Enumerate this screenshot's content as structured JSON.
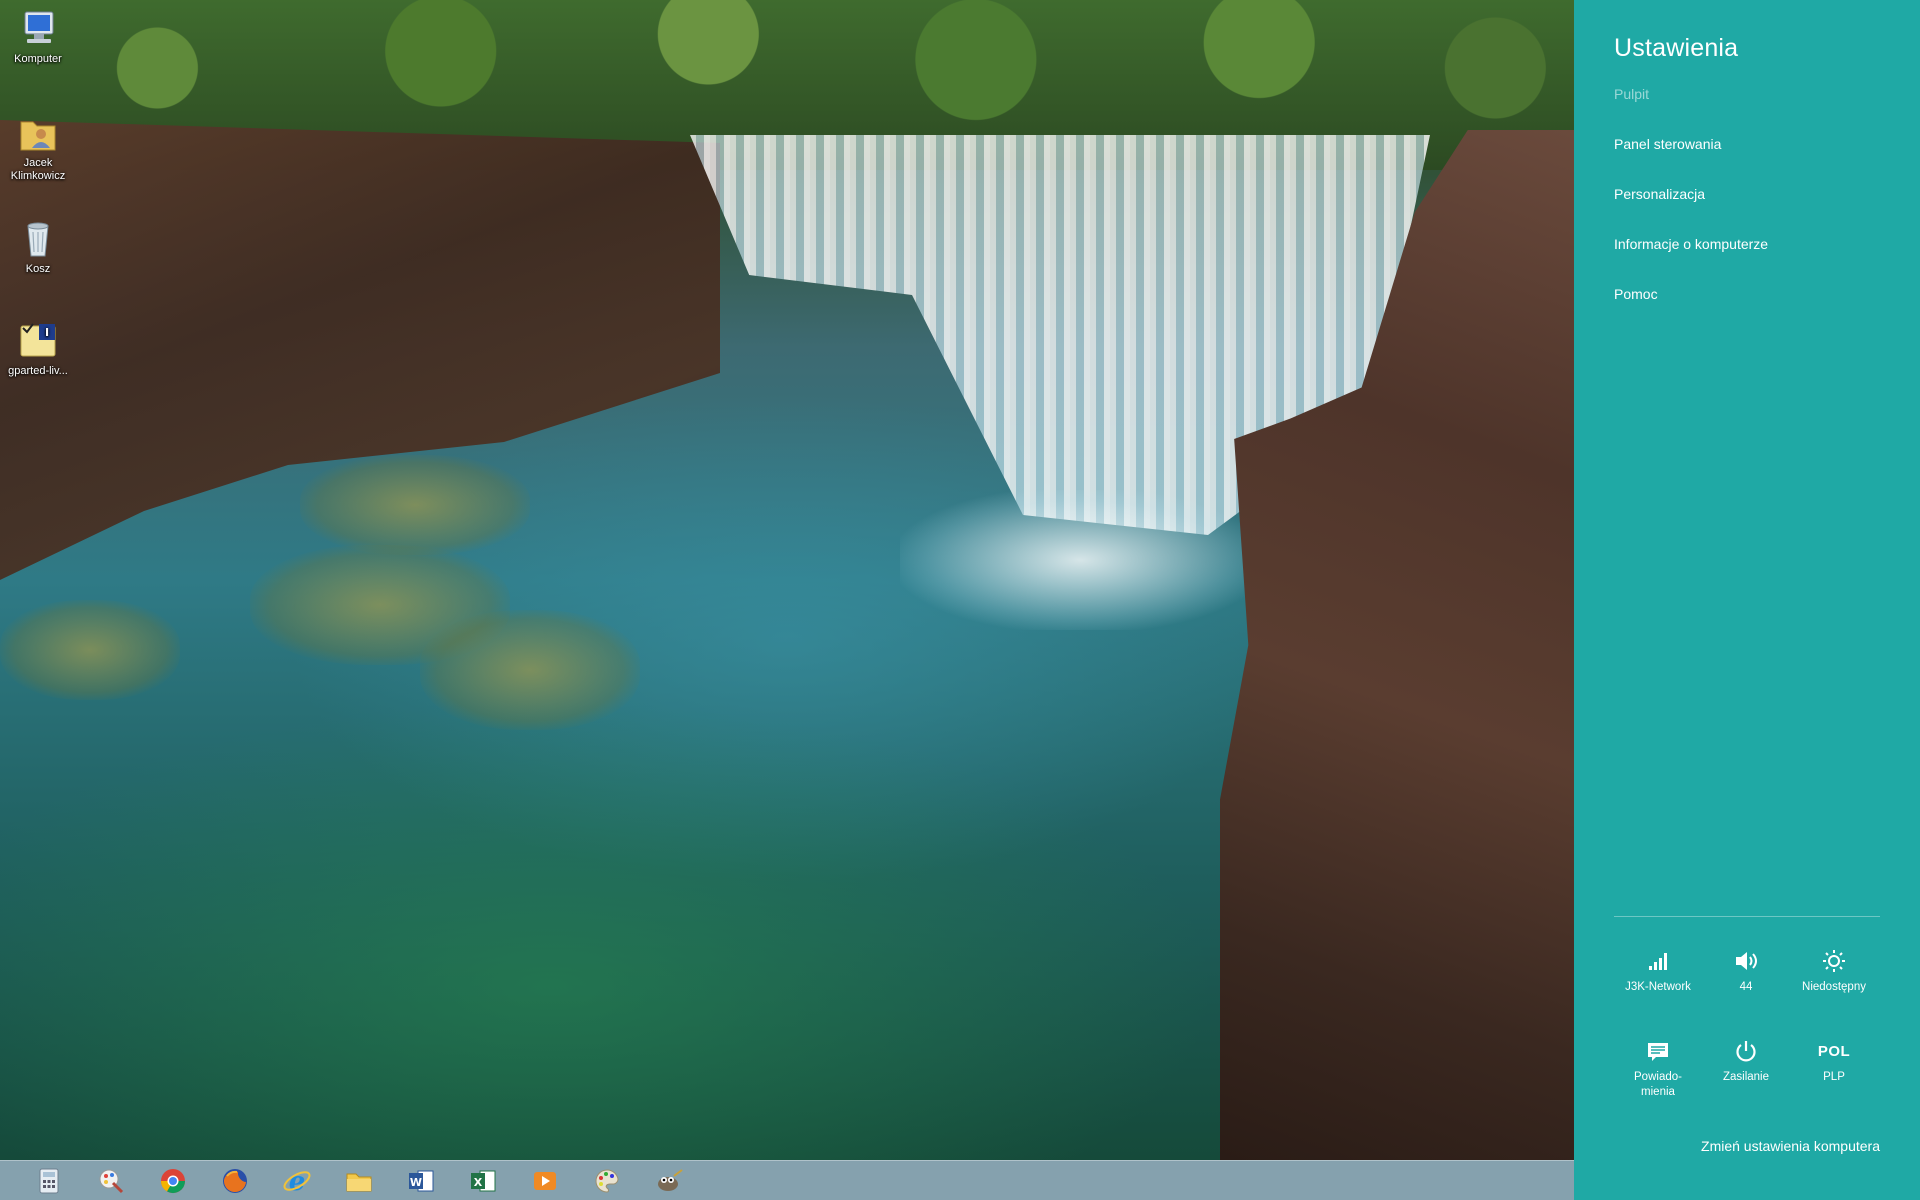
{
  "desktop": {
    "icons": [
      {
        "label": "Komputer",
        "icon": "computer-icon"
      },
      {
        "label": "Jacek Klimkowicz",
        "icon": "user-folder-icon"
      },
      {
        "label": "Kosz",
        "icon": "recycle-bin-icon"
      },
      {
        "label": "gparted-liv...",
        "icon": "disk-image-file-icon"
      }
    ]
  },
  "taskbar": {
    "apps": [
      {
        "name": "calculator-icon"
      },
      {
        "name": "paint-icon"
      },
      {
        "name": "chrome-icon"
      },
      {
        "name": "firefox-icon"
      },
      {
        "name": "internet-explorer-icon"
      },
      {
        "name": "file-explorer-icon"
      },
      {
        "name": "word-icon"
      },
      {
        "name": "excel-icon"
      },
      {
        "name": "media-player-icon"
      },
      {
        "name": "paint-palette-icon"
      },
      {
        "name": "gimp-icon"
      }
    ]
  },
  "settings": {
    "title": "Ustawienia",
    "context": "Pulpit",
    "links": [
      "Panel sterowania",
      "Personalizacja",
      "Informacje o komputerze",
      "Pomoc"
    ],
    "quick": {
      "network": {
        "label": "J3K-Network",
        "icon": "wifi-signal-icon"
      },
      "volume": {
        "label": "44",
        "icon": "speaker-icon"
      },
      "brightness": {
        "label": "Niedostępny",
        "icon": "brightness-icon"
      },
      "notifications": {
        "label": "Powiado-\nmienia",
        "icon": "notifications-icon"
      },
      "power": {
        "label": "Zasilanie",
        "icon": "power-icon"
      },
      "keyboard": {
        "label": "PLP",
        "code": "POL",
        "icon": "keyboard-layout-icon"
      }
    },
    "change_pc_settings": "Zmień ustawienia komputera"
  },
  "colors": {
    "charm_background": "#1fa9a5",
    "taskbar_background": "#96afbe"
  }
}
